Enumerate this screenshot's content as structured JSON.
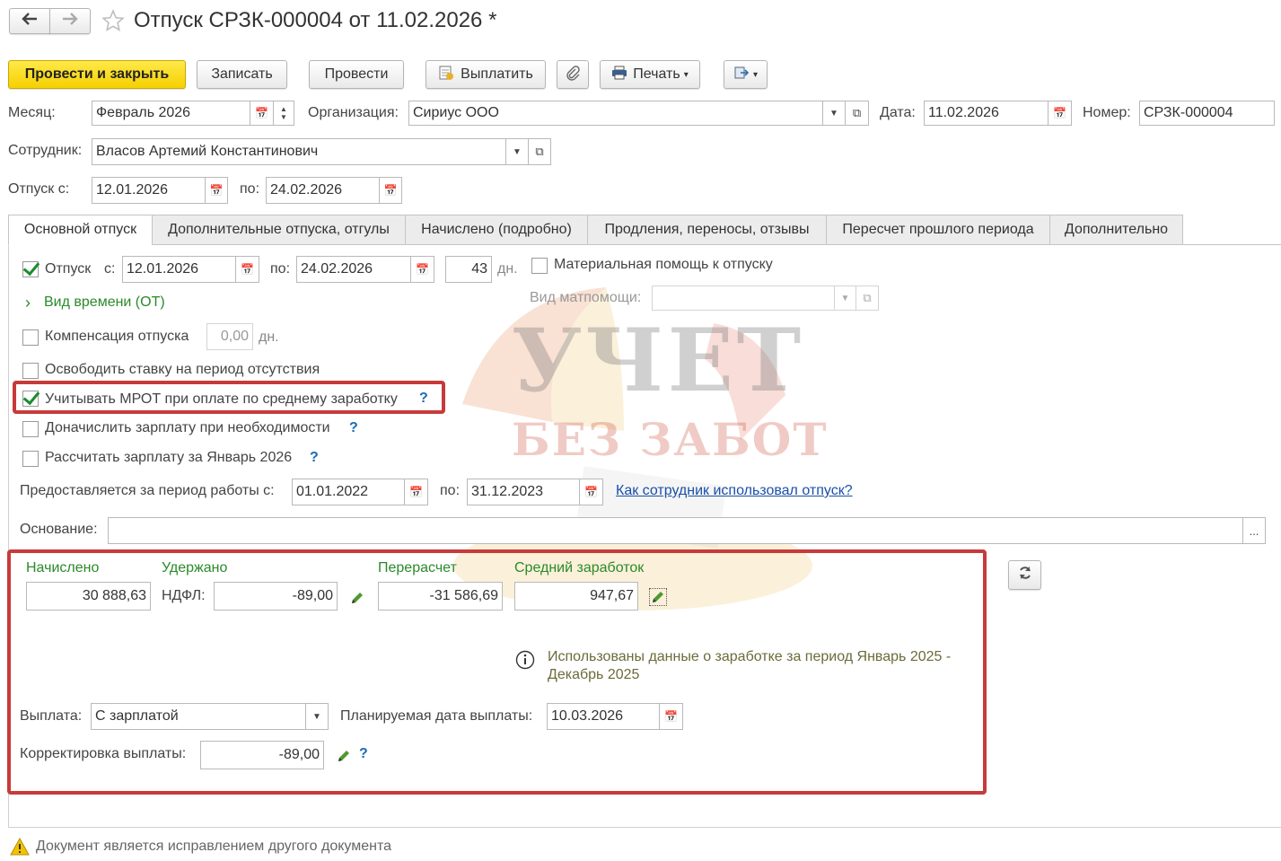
{
  "title": "Отпуск СРЗК-000004 от 11.02.2026 *",
  "nav": {
    "back_icon": "arrow-left-icon",
    "forward_icon": "arrow-right-icon",
    "favorite_icon": "star-icon"
  },
  "toolbar": {
    "post_close": "Провести и закрыть",
    "save": "Записать",
    "post": "Провести",
    "pay": "Выплатить",
    "print": "Печать",
    "attach_icon": "paperclip-icon",
    "more_icon": "export-icon"
  },
  "header": {
    "month_label": "Месяц:",
    "month_value": "Февраль 2026",
    "org_label": "Организация:",
    "org_value": "Сириус ООО",
    "date_label": "Дата:",
    "date_value": "11.02.2026",
    "number_label": "Номер:",
    "number_value": "СРЗК-000004",
    "employee_label": "Сотрудник:",
    "employee_value": "Власов Артемий Константинович",
    "vac_from_label": "Отпуск с:",
    "vac_from_value": "12.01.2026",
    "vac_to_label": "по:",
    "vac_to_value": "24.02.2026"
  },
  "tabs": [
    {
      "label": "Основной отпуск"
    },
    {
      "label": "Дополнительные отпуска, отгулы"
    },
    {
      "label": "Начислено (подробно)"
    },
    {
      "label": "Продления, переносы, отзывы"
    },
    {
      "label": "Пересчет прошлого периода"
    },
    {
      "label": "Дополнительно"
    }
  ],
  "main": {
    "vacation_label": "Отпуск",
    "vacation_from_label": "с:",
    "vacation_from": "12.01.2026",
    "vacation_to_label": "по:",
    "vacation_to": "24.02.2026",
    "days": "43",
    "days_unit": "дн.",
    "mat_help_label": "Материальная помощь к отпуску",
    "mat_help_kind_label": "Вид матпомощи:",
    "time_kind": "Вид времени (ОТ)",
    "compensation_label": "Компенсация отпуска",
    "compensation_value": "0,00",
    "compensation_unit": "дн.",
    "free_rate_label": "Освободить ставку на период отсутствия",
    "mrot_label": "Учитывать МРОТ при оплате по среднему заработку",
    "accrue_label": "Доначислить зарплату при необходимости",
    "calc_label": "Рассчитать зарплату за Январь 2026",
    "period_label": "Предоставляется за период работы с:",
    "period_from": "01.01.2022",
    "period_to_label": "по:",
    "period_to": "31.12.2023",
    "usage_link": "Как сотрудник использовал отпуск?",
    "basis_label": "Основание:",
    "basis_value": "",
    "basis_btn": "..."
  },
  "totals": {
    "accrued_label": "Начислено",
    "accrued_value": "30 888,63",
    "withheld_label": "Удержано",
    "ndfl_label": "НДФЛ:",
    "ndfl_value": "-89,00",
    "recalc_label": "Перерасчет",
    "recalc_value": "-31 586,69",
    "avg_label": "Средний заработок",
    "avg_value": "947,67",
    "info_text_1": "Использованы данные о заработке за период Январь 2025 -",
    "info_text_2": "Декабрь 2025",
    "payment_label": "Выплата:",
    "payment_value": "С зарплатой",
    "planned_date_label": "Планируемая дата выплаты:",
    "planned_date_value": "10.03.2026",
    "correction_label": "Корректировка выплаты:",
    "correction_value": "-89,00"
  },
  "footer": {
    "warning": "Документ является исправлением другого документа"
  },
  "watermark": {
    "line1": "УЧЕТ",
    "line2": "БЕЗ ЗАБОТ"
  },
  "colors": {
    "accent_yellow": "#f5d000",
    "highlight_red": "#c83a3a",
    "green_text": "#2a8a2a",
    "link_blue": "#1a4fa8"
  }
}
